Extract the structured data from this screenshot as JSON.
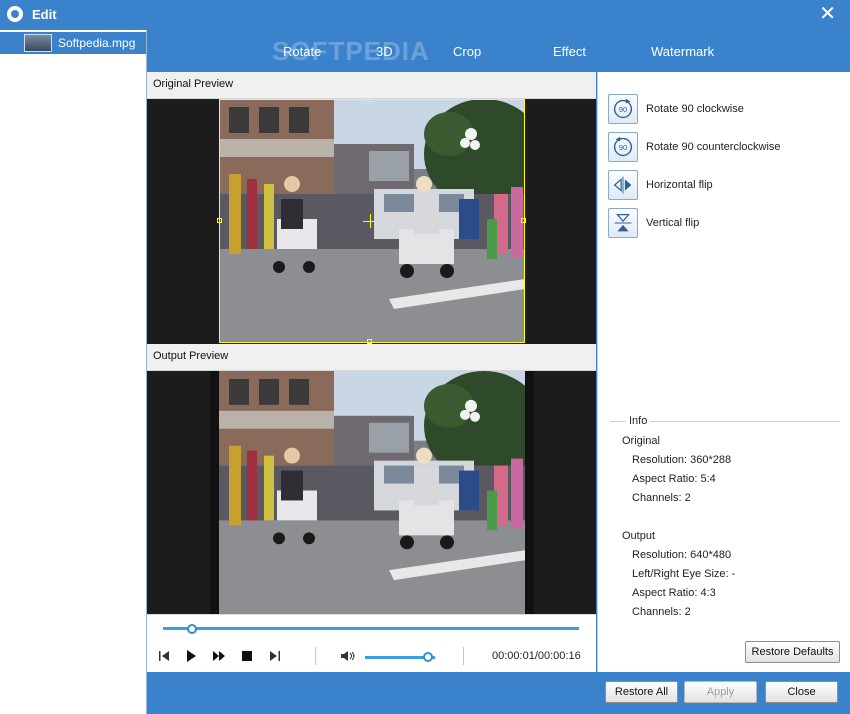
{
  "window": {
    "title": "Edit",
    "close_glyph": "✕"
  },
  "sidebar": {
    "files": [
      {
        "name": "Softpedia.mpg"
      }
    ]
  },
  "tabs": [
    {
      "label": "Rotate"
    },
    {
      "label": "3D"
    },
    {
      "label": "Crop"
    },
    {
      "label": "Effect"
    },
    {
      "label": "Watermark"
    }
  ],
  "brand_watermark": "SOFTPEDIA",
  "preview": {
    "original_label": "Original Preview",
    "output_label": "Output Preview"
  },
  "playback": {
    "time": "00:00:01/00:00:16",
    "progress": 0.07,
    "volume": 0.9
  },
  "rotate_actions": [
    {
      "label": "Rotate 90 clockwise",
      "icon": "rotate-clockwise-icon",
      "badge": "90"
    },
    {
      "label": "Rotate 90 counterclockwise",
      "icon": "rotate-counterclockwise-icon",
      "badge": "90"
    },
    {
      "label": "Horizontal flip",
      "icon": "horizontal-flip-icon"
    },
    {
      "label": "Vertical flip",
      "icon": "vertical-flip-icon"
    }
  ],
  "info": {
    "title": "Info",
    "original": {
      "heading": "Original",
      "lines": [
        "Resolution: 360*288",
        "Aspect Ratio: 5:4",
        "Channels: 2"
      ]
    },
    "output": {
      "heading": "Output",
      "lines": [
        "Resolution: 640*480",
        "Left/Right Eye Size: -",
        "Aspect Ratio: 4:3",
        "Channels: 2"
      ]
    }
  },
  "buttons": {
    "restore_defaults": "Restore Defaults",
    "restore_all": "Restore All",
    "apply": "Apply",
    "close": "Close"
  },
  "colors": {
    "accent": "#3b82cc",
    "crop_frame": "#ffff00",
    "slider": "#3aa0dc"
  }
}
